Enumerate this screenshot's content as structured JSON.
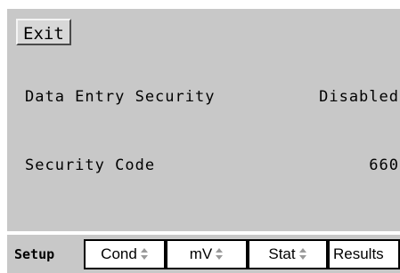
{
  "toolbar": {
    "exit_label": "Exit"
  },
  "settings": {
    "data_entry_security": {
      "label": "Data Entry Security",
      "value": "Disabled"
    },
    "security_code": {
      "label": "Security Code",
      "value": "660"
    }
  },
  "tabs": [
    {
      "label": "Setup",
      "active": true
    },
    {
      "label": "Cond",
      "spinner": "up-down-arrow-icon"
    },
    {
      "label": "mV",
      "spinner": "up-down-arrow-icon"
    },
    {
      "label": "Stat",
      "spinner": "up-down-arrow-icon"
    },
    {
      "label": "Results"
    }
  ]
}
